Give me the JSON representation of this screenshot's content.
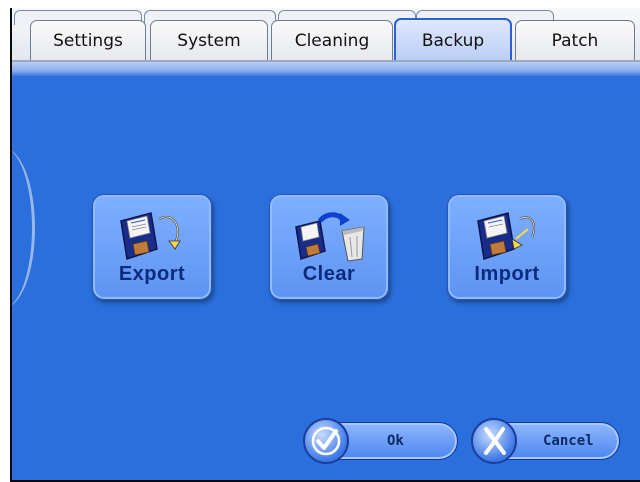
{
  "tabs": [
    {
      "label": "Settings"
    },
    {
      "label": "System"
    },
    {
      "label": "Cleaning"
    },
    {
      "label": "Backup",
      "active": true
    },
    {
      "label": "Patch"
    }
  ],
  "actions": {
    "export_label": "Export",
    "clear_label": "Clear",
    "import_label": "Import"
  },
  "dialog": {
    "ok_label": "Ok",
    "cancel_label": "Cancel"
  },
  "colors": {
    "panel": "#2a6fdc",
    "button": "#6fa2f8",
    "label": "#0a2c7c"
  },
  "icons": [
    "floppy-export-icon",
    "floppy-clear-icon",
    "floppy-import-icon",
    "check-icon",
    "cross-icon"
  ]
}
